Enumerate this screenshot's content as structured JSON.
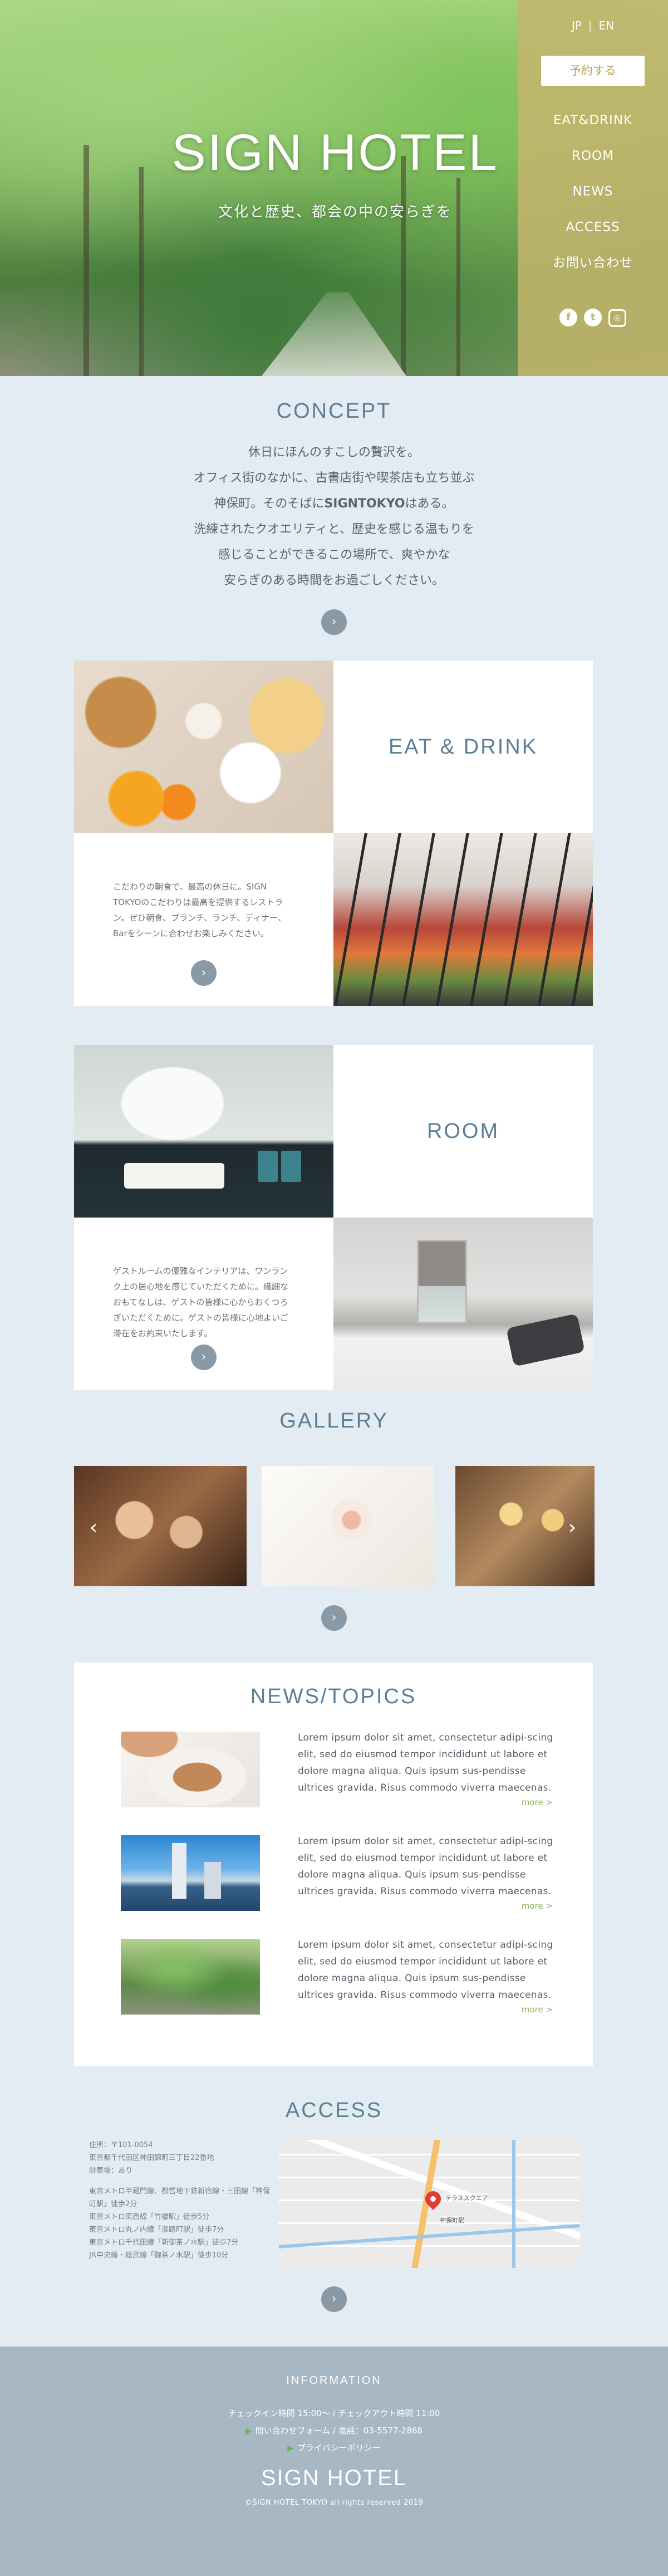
{
  "hero": {
    "title": "SIGN HOTEL",
    "subtitle": "文化と歴史、都会の中の安らぎを"
  },
  "nav": {
    "lang_jp": "JP",
    "lang_sep": "|",
    "lang_en": "EN",
    "reserve": "予約する",
    "items": [
      "EAT&DRINK",
      "ROOM",
      "NEWS",
      "ACCESS",
      "お問い合わせ"
    ],
    "social": [
      "facebook-icon",
      "twitter-icon",
      "instagram-icon"
    ]
  },
  "concept": {
    "title": "CONCEPT",
    "line1": "休日にほんのすこしの贅沢を。",
    "line2": "オフィス街のなかに、古書店街や喫茶店も立ち並ぶ",
    "line3_pre": "神保町。そのそばに",
    "line3_brand": "SIGNTOKYO",
    "line3_post": "はある。",
    "line4": "洗練されたクオエリティと、歴史を感じる温もりを",
    "line5": "感じることができるこの場所で、爽やかな",
    "line6": "安らぎのある時間をお過ごしください。"
  },
  "eat": {
    "title": "EAT & DRINK",
    "text": "こだわりの朝食で、最高の休日に。SIGN TOKYOのこだわりは最高を提供するレストラン。ぜひ朝食、ブランチ、ランチ、ディナー、Barをシーンに合わせお楽しみください。"
  },
  "room": {
    "title": "ROOM",
    "text": "ゲストルームの優雅なインテリアは、ワンランク上の居心地を感じていただくために。繊細なおもてなしは、ゲストの皆様に心からおくつろぎいただくために。ゲストの皆様に心地よいご滞在をお約束いたします。"
  },
  "gallery": {
    "title": "GALLERY",
    "prev": "‹",
    "next": "›"
  },
  "news": {
    "title": "NEWS/TOPICS",
    "items": [
      {
        "text": "Lorem ipsum dolor sit amet, consectetur adipi-scing elit, sed do eiusmod tempor incididunt ut labore et dolore magna aliqua. Quis ipsum sus-pendisse ultrices gravida. Risus commodo viverra maecenas.",
        "more": "more >"
      },
      {
        "text": "Lorem ipsum dolor sit amet, consectetur adipi-scing elit, sed do eiusmod tempor incididunt ut labore et dolore magna aliqua. Quis ipsum sus-pendisse ultrices gravida. Risus commodo viverra maecenas.",
        "more": "more >"
      },
      {
        "text": "Lorem ipsum dolor sit amet, consectetur adipi-scing elit, sed do eiusmod tempor incididunt ut labore et dolore magna aliqua. Quis ipsum sus-pendisse ultrices gravida. Risus commodo viverra maecenas.",
        "more": "more >"
      }
    ]
  },
  "access": {
    "title": "ACCESS",
    "address": "住所：〒101-0054",
    "address2": "東京都千代田区神田錦町三丁目22番地",
    "parking": "駐車場：あり",
    "routes": [
      "東京メトロ半蔵門線、都営地下鉄新宿線・三田線「神保町駅」徒歩2分",
      "東京メトロ東西線「竹橋駅」徒歩5分",
      "東京メトロ丸ノ内線「淡路町駅」徒歩7分",
      "東京メトロ千代田線「新御茶ノ水駅」徒歩7分",
      "JR中央線・総武線「御茶ノ水駅」徒歩10分"
    ],
    "map_place": "テラススクエア",
    "map_station": "神保町駅"
  },
  "footer": {
    "heading": "INFORMATION",
    "hours": "チェックイン時間 15:00〜 / チェックアウト時間 11:00",
    "contact_link": "問い合わせフォーム",
    "phone": " / 電話：03-5577-2868",
    "privacy_link": "プライバシーポリシー",
    "logo": "SIGN HOTEL",
    "copyright": "©SIGN HOTEL TOKYO all rights reserved 2019"
  },
  "colors": {
    "background": "#e3ebf3",
    "accent_blue": "#5c7f95",
    "side_nav_gold": "#c4b46e",
    "more_green": "#8fb45a",
    "footer": "#a8b7c4"
  }
}
